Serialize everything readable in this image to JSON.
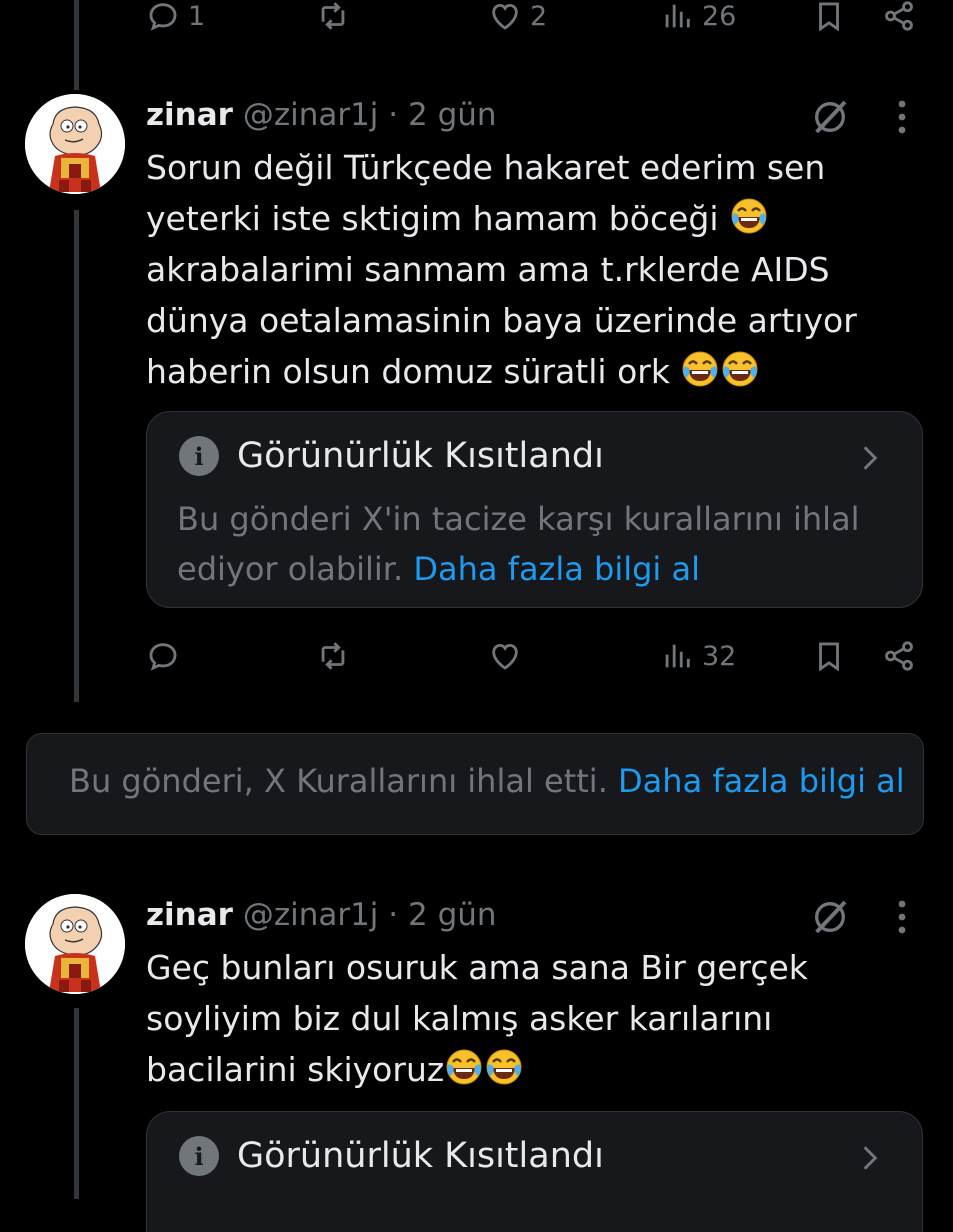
{
  "top_actions": {
    "reply_count": "1",
    "repost_count": "",
    "like_count": "2",
    "view_count": "26"
  },
  "tweet1": {
    "name": "zinar",
    "handle": "@zinar1j",
    "time": "· 2 gün",
    "lines": [
      "Sorun değil Türkçede hakaret ederim sen",
      "yeterki iste sktigim hamam böceği",
      "akrabalarimi sanmam ama t.rklerde AIDS",
      "dünya oetalamasinin baya üzerinde artıyor",
      "haberin olsun domuz süratli ork"
    ],
    "notice": {
      "title": "Görünürlük Kısıtlandı",
      "text": "Bu gönderi X'in tacize karşı kurallarını ihlal ediyor olabilir.",
      "link": "Daha fazla bilgi al"
    },
    "view_count": "32"
  },
  "violation_banner": {
    "text": "Bu gönderi, X Kurallarını ihlal etti.",
    "link": "Daha fazla bilgi al"
  },
  "tweet2": {
    "name": "zinar",
    "handle": "@zinar1j",
    "time": "· 2 gün",
    "lines": [
      "Geç bunları osuruk ama sana Bir gerçek",
      "soyliyim biz dul kalmış asker karılarını",
      "bacilarini skiyoruz"
    ],
    "notice": {
      "title": "Görünürlük Kısıtlandı"
    }
  },
  "icons": {
    "reply": "reply-icon",
    "repost": "repost-icon",
    "like": "heart-icon",
    "views": "views-icon",
    "bookmark": "bookmark-icon",
    "share": "share-icon",
    "grok": "grok-icon",
    "more": "more-icon",
    "info": "info-icon",
    "chevron": "chevron-right-icon",
    "emoji": "laughing-tears-emoji"
  },
  "colors": {
    "background": "#000000",
    "card": "#16181c",
    "border": "#2f3336",
    "muted": "#71767b",
    "link": "#1d9bf0",
    "text": "#e7e9ea"
  }
}
